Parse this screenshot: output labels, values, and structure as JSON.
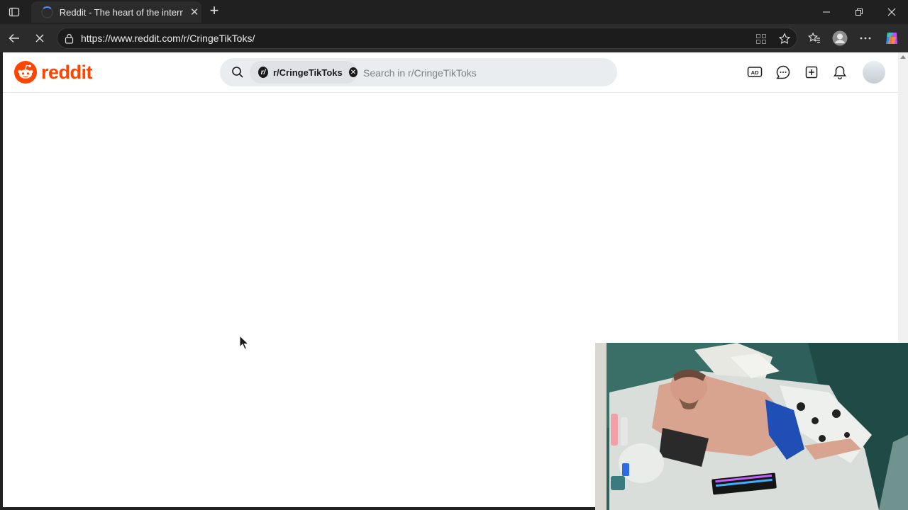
{
  "browser": {
    "tab": {
      "title": "Reddit - The heart of the internet",
      "icons": [
        "loading-spinner-icon",
        "close-icon"
      ]
    },
    "address_bar": {
      "url": "https://www.reddit.com/r/CringeTikToks/"
    },
    "toolbar_icons": [
      "back-icon",
      "stop-loading-icon",
      "site-info-icon",
      "app-available-icon",
      "favorite-star-icon",
      "favorites-icon",
      "profile-icon",
      "more-icon",
      "copilot-icon"
    ],
    "window_controls": [
      "minimize-icon",
      "restore-icon",
      "close-icon"
    ]
  },
  "reddit": {
    "logo_text": "reddit",
    "brand_color": "#ff4500",
    "search": {
      "community_chip": "r/CringeTikToks",
      "placeholder": "Search in r/CringeTikToks"
    },
    "header_icons": [
      "advertise-icon",
      "chat-icon",
      "create-post-icon",
      "notifications-icon",
      "avatar"
    ]
  },
  "overlay": {
    "webcam": "streamer webcam feed"
  }
}
